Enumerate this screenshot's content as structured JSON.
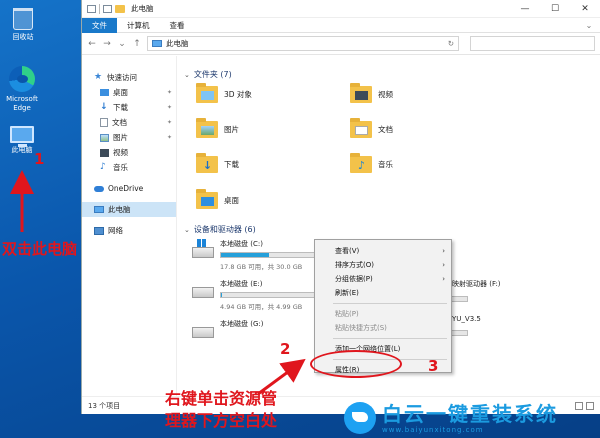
{
  "desktop": {
    "icons": [
      {
        "label": "回收站"
      },
      {
        "label": "Microsoft Edge"
      },
      {
        "label": "此电脑"
      }
    ]
  },
  "window": {
    "title": "此电脑",
    "controls": [
      "—",
      "☐",
      "✕"
    ],
    "ribbon_tabs": [
      "文件",
      "计算机",
      "查看"
    ],
    "address": "此电脑",
    "nav_buttons": [
      "←",
      "→",
      "⌄",
      "↑"
    ]
  },
  "sidebar": {
    "items": [
      {
        "label": "快速访问",
        "icon": "star-icon"
      },
      {
        "label": "桌面",
        "icon": "desktop-icon",
        "pinned": true
      },
      {
        "label": "下载",
        "icon": "download-icon",
        "pinned": true
      },
      {
        "label": "文档",
        "icon": "document-icon",
        "pinned": true
      },
      {
        "label": "图片",
        "icon": "picture-icon",
        "pinned": true
      },
      {
        "label": "视频",
        "icon": "video-icon"
      },
      {
        "label": "音乐",
        "icon": "music-icon"
      },
      {
        "label": "OneDrive",
        "icon": "cloud-icon"
      },
      {
        "label": "此电脑",
        "icon": "computer-icon"
      },
      {
        "label": "网络",
        "icon": "network-icon"
      }
    ]
  },
  "folders": {
    "header": "文件夹 (7)",
    "items": [
      "3D 对象",
      "视频",
      "图片",
      "文档",
      "下载",
      "音乐",
      "桌面"
    ]
  },
  "drives": {
    "header": "设备和驱动器 (6)",
    "items": [
      {
        "name": "本地磁盘 (C:)",
        "info": "17.8 GB 可用，共 30.0 GB",
        "used": 0.41
      },
      {
        "name": "本地磁盘 (E:)",
        "info": "4.94 GB 可用，共 4.99 GB",
        "used": 0.01
      },
      {
        "name": "本地磁盘 (G:)",
        "info": "",
        "used": 0
      }
    ],
    "partial_labels": [
      "映射驱动器 (F:)",
      "YU_V3.5"
    ]
  },
  "context_menu": {
    "items": [
      {
        "label": "查看(V)",
        "submenu": true,
        "disabled": false
      },
      {
        "label": "排序方式(O)",
        "submenu": true,
        "disabled": false
      },
      {
        "label": "分组依据(P)",
        "submenu": true,
        "disabled": false
      },
      {
        "label": "刷新(E)",
        "submenu": false,
        "disabled": false
      },
      {
        "label": "粘贴(P)",
        "submenu": false,
        "disabled": true
      },
      {
        "label": "粘贴快捷方式(S)",
        "submenu": false,
        "disabled": true
      },
      {
        "label": "添加一个网络位置(L)",
        "submenu": false,
        "disabled": false
      },
      {
        "label": "属性(R)",
        "submenu": false,
        "disabled": false
      }
    ],
    "arrow": "›"
  },
  "status": {
    "count": "13 个项目"
  },
  "annotations": {
    "step1": "1",
    "step2": "2",
    "step3": "3",
    "caption1": "双击此电脑",
    "caption2_line1": "右键单击资源管",
    "caption2_line2": "理器下方空白处"
  },
  "watermark": {
    "title": "白云一键重装系统",
    "url": "www.baiyunxitong.com"
  },
  "colors": {
    "accent": "#1979ca",
    "annotation_red": "#e0161d",
    "watermark_blue": "#1b9be0"
  }
}
